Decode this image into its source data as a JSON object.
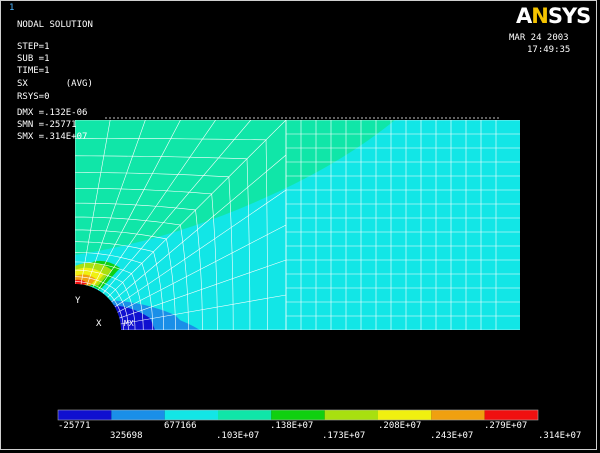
{
  "window_number": "1",
  "header": {
    "title": "NODAL SOLUTION",
    "lines": [
      "STEP=1",
      "SUB =1",
      "TIME=1",
      "SX       (AVG)",
      "RSYS=0",
      "DMX =.132E-06",
      "SMN =-25771",
      "SMX =.314E+07"
    ]
  },
  "logo": {
    "a": "A",
    "n": "N",
    "sys": "SYS"
  },
  "datetime": {
    "date": "MAR 24 2003",
    "time": "17:49:35"
  },
  "triad": {
    "y": "Y",
    "x": "X",
    "mx": "MX"
  },
  "legend": {
    "colors": [
      "#1010d0",
      "#1a8fe8",
      "#12e6e6",
      "#10e6a8",
      "#10d010",
      "#a8e010",
      "#f0f010",
      "#f0a010",
      "#f01010"
    ],
    "labels_bottom": [
      "-25771",
      "677166",
      ".138E+07",
      ".208E+07",
      ".279E+07"
    ],
    "labels_top": [
      "325698",
      ".103E+07",
      ".173E+07",
      ".243E+07",
      ".314E+07"
    ]
  },
  "colors": {
    "background": "#000000",
    "mesh": "#ffffff",
    "dominant": "#12e6e6"
  }
}
